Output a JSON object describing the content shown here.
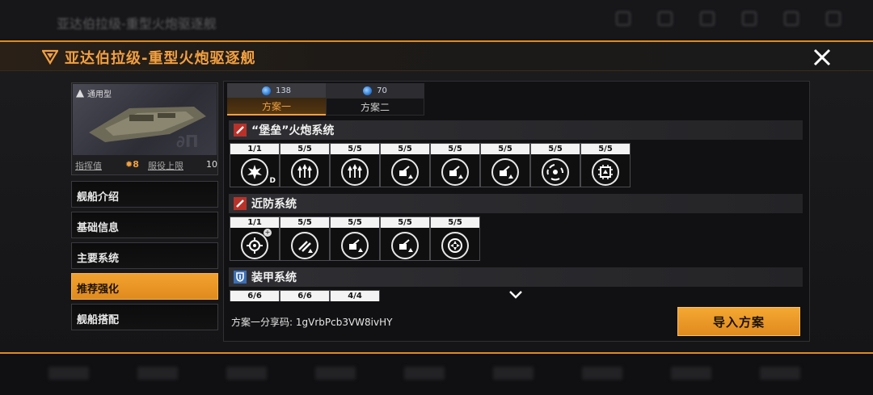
{
  "background": {
    "top_title": "亚达伯拉级-重型火炮驱逐舰"
  },
  "modal": {
    "title": "亚达伯拉级-重型火炮驱逐舰",
    "accent_color": "#e08a1e"
  },
  "ship_card": {
    "type_label": "通用型",
    "command_label": "指挥值",
    "command_value": "8",
    "service_label": "服役上限",
    "service_value": "10"
  },
  "menu": {
    "items": [
      {
        "label": "舰船介绍",
        "active": false
      },
      {
        "label": "基础信息",
        "active": false
      },
      {
        "label": "主要系统",
        "active": false
      },
      {
        "label": "推荐强化",
        "active": true
      },
      {
        "label": "舰船搭配",
        "active": false
      }
    ]
  },
  "tabs": [
    {
      "cost": "138",
      "label": "方案一",
      "active": true
    },
    {
      "cost": "70",
      "label": "方案二",
      "active": false
    }
  ],
  "systems": [
    {
      "name": "“堡垒”火炮系统",
      "icon": "cannon-icon",
      "color": "#b8322a",
      "slots": [
        "1/1",
        "5/5",
        "5/5",
        "5/5",
        "5/5",
        "5/5",
        "5/5",
        "5/5"
      ]
    },
    {
      "name": "近防系统",
      "icon": "cannon-icon",
      "color": "#b8322a",
      "slots": [
        "1/1",
        "5/5",
        "5/5",
        "5/5",
        "5/5"
      ]
    },
    {
      "name": "装甲系统",
      "icon": "shield-icon",
      "color": "#3b6fb8",
      "slots": [
        "6/6",
        "6/6",
        "4/4"
      ]
    }
  ],
  "footer": {
    "share_label": "方案一分享码: 1gVrbPcb3VW8ivHY",
    "import_button": "导入方案"
  }
}
